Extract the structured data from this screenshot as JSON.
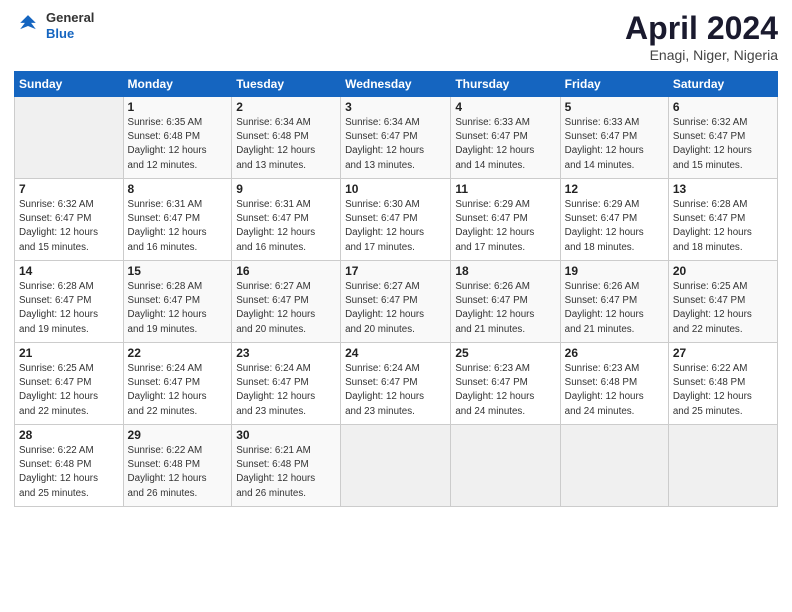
{
  "header": {
    "logo_line1": "General",
    "logo_line2": "Blue",
    "month": "April 2024",
    "location": "Enagi, Niger, Nigeria"
  },
  "weekdays": [
    "Sunday",
    "Monday",
    "Tuesday",
    "Wednesday",
    "Thursday",
    "Friday",
    "Saturday"
  ],
  "weeks": [
    [
      {
        "day": "",
        "info": ""
      },
      {
        "day": "1",
        "info": "Sunrise: 6:35 AM\nSunset: 6:48 PM\nDaylight: 12 hours\nand 12 minutes."
      },
      {
        "day": "2",
        "info": "Sunrise: 6:34 AM\nSunset: 6:48 PM\nDaylight: 12 hours\nand 13 minutes."
      },
      {
        "day": "3",
        "info": "Sunrise: 6:34 AM\nSunset: 6:47 PM\nDaylight: 12 hours\nand 13 minutes."
      },
      {
        "day": "4",
        "info": "Sunrise: 6:33 AM\nSunset: 6:47 PM\nDaylight: 12 hours\nand 14 minutes."
      },
      {
        "day": "5",
        "info": "Sunrise: 6:33 AM\nSunset: 6:47 PM\nDaylight: 12 hours\nand 14 minutes."
      },
      {
        "day": "6",
        "info": "Sunrise: 6:32 AM\nSunset: 6:47 PM\nDaylight: 12 hours\nand 15 minutes."
      }
    ],
    [
      {
        "day": "7",
        "info": "Sunrise: 6:32 AM\nSunset: 6:47 PM\nDaylight: 12 hours\nand 15 minutes."
      },
      {
        "day": "8",
        "info": "Sunrise: 6:31 AM\nSunset: 6:47 PM\nDaylight: 12 hours\nand 16 minutes."
      },
      {
        "day": "9",
        "info": "Sunrise: 6:31 AM\nSunset: 6:47 PM\nDaylight: 12 hours\nand 16 minutes."
      },
      {
        "day": "10",
        "info": "Sunrise: 6:30 AM\nSunset: 6:47 PM\nDaylight: 12 hours\nand 17 minutes."
      },
      {
        "day": "11",
        "info": "Sunrise: 6:29 AM\nSunset: 6:47 PM\nDaylight: 12 hours\nand 17 minutes."
      },
      {
        "day": "12",
        "info": "Sunrise: 6:29 AM\nSunset: 6:47 PM\nDaylight: 12 hours\nand 18 minutes."
      },
      {
        "day": "13",
        "info": "Sunrise: 6:28 AM\nSunset: 6:47 PM\nDaylight: 12 hours\nand 18 minutes."
      }
    ],
    [
      {
        "day": "14",
        "info": "Sunrise: 6:28 AM\nSunset: 6:47 PM\nDaylight: 12 hours\nand 19 minutes."
      },
      {
        "day": "15",
        "info": "Sunrise: 6:28 AM\nSunset: 6:47 PM\nDaylight: 12 hours\nand 19 minutes."
      },
      {
        "day": "16",
        "info": "Sunrise: 6:27 AM\nSunset: 6:47 PM\nDaylight: 12 hours\nand 20 minutes."
      },
      {
        "day": "17",
        "info": "Sunrise: 6:27 AM\nSunset: 6:47 PM\nDaylight: 12 hours\nand 20 minutes."
      },
      {
        "day": "18",
        "info": "Sunrise: 6:26 AM\nSunset: 6:47 PM\nDaylight: 12 hours\nand 21 minutes."
      },
      {
        "day": "19",
        "info": "Sunrise: 6:26 AM\nSunset: 6:47 PM\nDaylight: 12 hours\nand 21 minutes."
      },
      {
        "day": "20",
        "info": "Sunrise: 6:25 AM\nSunset: 6:47 PM\nDaylight: 12 hours\nand 22 minutes."
      }
    ],
    [
      {
        "day": "21",
        "info": "Sunrise: 6:25 AM\nSunset: 6:47 PM\nDaylight: 12 hours\nand 22 minutes."
      },
      {
        "day": "22",
        "info": "Sunrise: 6:24 AM\nSunset: 6:47 PM\nDaylight: 12 hours\nand 22 minutes."
      },
      {
        "day": "23",
        "info": "Sunrise: 6:24 AM\nSunset: 6:47 PM\nDaylight: 12 hours\nand 23 minutes."
      },
      {
        "day": "24",
        "info": "Sunrise: 6:24 AM\nSunset: 6:47 PM\nDaylight: 12 hours\nand 23 minutes."
      },
      {
        "day": "25",
        "info": "Sunrise: 6:23 AM\nSunset: 6:47 PM\nDaylight: 12 hours\nand 24 minutes."
      },
      {
        "day": "26",
        "info": "Sunrise: 6:23 AM\nSunset: 6:48 PM\nDaylight: 12 hours\nand 24 minutes."
      },
      {
        "day": "27",
        "info": "Sunrise: 6:22 AM\nSunset: 6:48 PM\nDaylight: 12 hours\nand 25 minutes."
      }
    ],
    [
      {
        "day": "28",
        "info": "Sunrise: 6:22 AM\nSunset: 6:48 PM\nDaylight: 12 hours\nand 25 minutes."
      },
      {
        "day": "29",
        "info": "Sunrise: 6:22 AM\nSunset: 6:48 PM\nDaylight: 12 hours\nand 26 minutes."
      },
      {
        "day": "30",
        "info": "Sunrise: 6:21 AM\nSunset: 6:48 PM\nDaylight: 12 hours\nand 26 minutes."
      },
      {
        "day": "",
        "info": ""
      },
      {
        "day": "",
        "info": ""
      },
      {
        "day": "",
        "info": ""
      },
      {
        "day": "",
        "info": ""
      }
    ]
  ]
}
